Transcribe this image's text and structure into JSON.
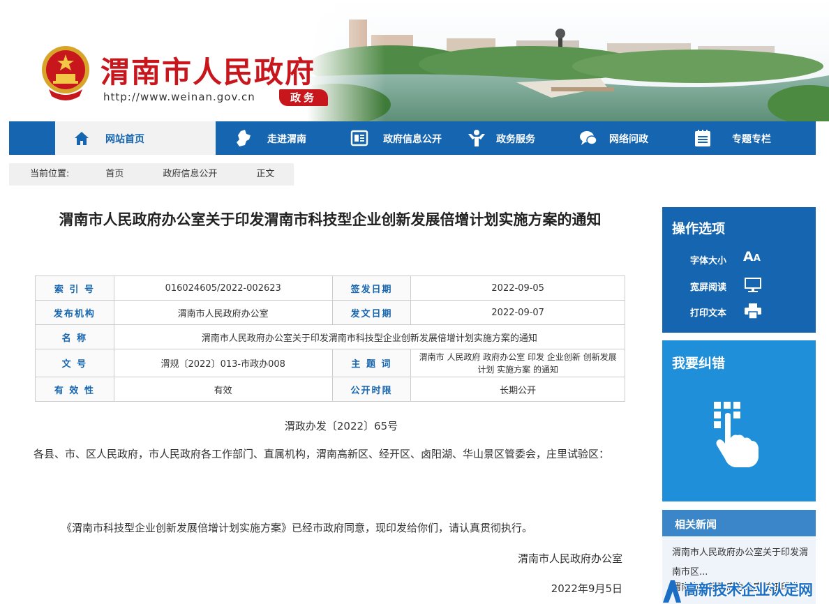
{
  "header": {
    "title": "渭南市人民政府",
    "url": "http://www.weinan.gov.cn",
    "badge": "政务"
  },
  "nav": {
    "items": [
      {
        "label": "网站首页",
        "icon": "home-icon",
        "active": true
      },
      {
        "label": "走进渭南",
        "icon": "map-icon"
      },
      {
        "label": "政府信息公开",
        "icon": "document-icon"
      },
      {
        "label": "政务服务",
        "icon": "people-icon"
      },
      {
        "label": "网络问政",
        "icon": "chat-icon"
      },
      {
        "label": "专题专栏",
        "icon": "calendar-list-icon"
      }
    ]
  },
  "breadcrumb": {
    "prefix": "当前位置:",
    "items": [
      "首页",
      "政府信息公开",
      "正文"
    ]
  },
  "article": {
    "title": "渭南市人民政府办公室关于印发渭南市科技型企业创新发展倍增计划实施方案的通知",
    "meta": {
      "index_label": "索 引 号",
      "index_value": "016024605/2022-002623",
      "sign_date_label": "签发日期",
      "sign_date_value": "2022-09-05",
      "org_label": "发布机构",
      "org_value": "渭南市人民政府办公室",
      "issue_date_label": "发文日期",
      "issue_date_value": "2022-09-07",
      "name_label": "名 称",
      "name_value": "渭南市人民政府办公室关于印发渭南市科技型企业创新发展倍增计划实施方案的通知",
      "docno_label": "文 号",
      "docno_value": "渭规〔2022〕013-市政办008",
      "subject_label": "主 题 词",
      "subject_value": "渭南市 人民政府 政府办公室 印发 企业创新 创新发展 计划 实施方案 的通知",
      "validity_label": "有 效 性",
      "validity_value": "有效",
      "disclosure_label": "公开时限",
      "disclosure_value": "长期公开"
    },
    "doc_number": "渭政办发〔2022〕65号",
    "addressee": "各县、市、区人民政府，市人民政府各工作部门、直属机构，渭南高新区、经开区、卤阳湖、华山景区管委会，庄里试验区：",
    "body": "《渭南市科技型企业创新发展倍增计划实施方案》已经市政府同意，现印发给你们，请认真贯彻执行。",
    "signature": "渭南市人民政府办公室",
    "date": "2022年9月5日"
  },
  "sidebar": {
    "ops_title": "操作选项",
    "font_size_label": "字体大小",
    "font_size_glyph_big": "A",
    "font_size_glyph_small": "A",
    "widescreen_label": "宽屏阅读",
    "print_label": "打印文本",
    "correction_title": "我要纠错",
    "news_title": "相关新闻",
    "news_items": [
      "渭南市人民政府办公室关于印发渭南市区...",
      "渭南市人民政府办公室关于印发"
    ]
  },
  "watermark": {
    "text": "高新技术企业认定网"
  },
  "colors": {
    "brand_red": "#c8161d",
    "nav_blue": "#1565b0",
    "light_blue": "#1e8fd8"
  }
}
